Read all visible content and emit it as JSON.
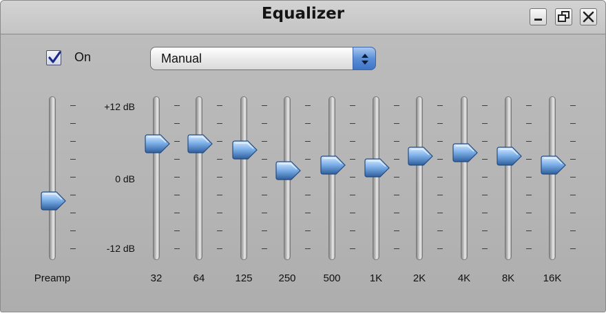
{
  "window": {
    "title": "Equalizer",
    "buttons": [
      {
        "name": "minimize-button",
        "icon": "minimize-icon"
      },
      {
        "name": "maximize-button",
        "icon": "maximize-icon"
      },
      {
        "name": "close-button",
        "icon": "close-icon"
      }
    ]
  },
  "on_toggle": {
    "label": "On",
    "checked": true
  },
  "preset": {
    "value": "Manual",
    "icon": "dropdown-arrows-icon"
  },
  "scale": {
    "top": "+12 dB",
    "middle": "0 dB",
    "bottom": "-12 dB",
    "max_db": 12,
    "min_db": -12
  },
  "preamp": {
    "label": "Preamp",
    "value_db": -4
  },
  "bands": [
    {
      "label": "32",
      "value_db": 5.5
    },
    {
      "label": "64",
      "value_db": 5.5
    },
    {
      "label": "125",
      "value_db": 4.5
    },
    {
      "label": "250",
      "value_db": 1.0
    },
    {
      "label": "500",
      "value_db": 2.0
    },
    {
      "label": "1K",
      "value_db": 1.5
    },
    {
      "label": "2K",
      "value_db": 3.5
    },
    {
      "label": "4K",
      "value_db": 4.0
    },
    {
      "label": "8K",
      "value_db": 3.5
    },
    {
      "label": "16K",
      "value_db": 2.0
    }
  ],
  "colors": {
    "knob": "#7fb2ea",
    "knob_dark": "#2f5f9e",
    "accent": "#3e74c6",
    "window_bg": "#b8b8b8"
  }
}
